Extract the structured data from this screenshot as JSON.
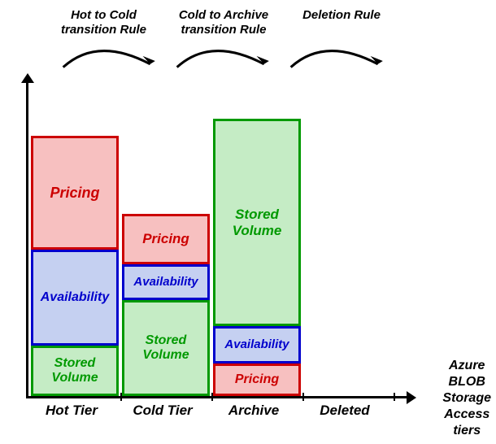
{
  "rules": {
    "hot_to_cold": "Hot to Cold\ntransition Rule",
    "cold_to_archive": "Cold to Archive\ntransition Rule",
    "deletion": "Deletion Rule"
  },
  "chart_data": {
    "type": "bar",
    "categories": [
      "Hot Tier",
      "Cold Tier",
      "Archive",
      "Deleted"
    ],
    "series": [
      {
        "name": "Pricing",
        "values": [
          100,
          50,
          15,
          0
        ]
      },
      {
        "name": "Availability",
        "values": [
          100,
          50,
          20,
          0
        ]
      },
      {
        "name": "Stored Volume",
        "values": [
          30,
          70,
          170,
          0
        ]
      }
    ],
    "title": "Azure BLOB Storage Access tiers",
    "xlabel": "",
    "ylabel": "",
    "ylim": [
      0,
      300
    ]
  },
  "segments": {
    "pricing": "Pricing",
    "availability": "Availability",
    "volume": "Stored\nVolume"
  },
  "tiers": {
    "hot": "Hot Tier",
    "cold": "Cold Tier",
    "archive": "Archive",
    "deleted": "Deleted"
  },
  "side_label": "Azure\nBLOB\nStorage\nAccess\ntiers"
}
